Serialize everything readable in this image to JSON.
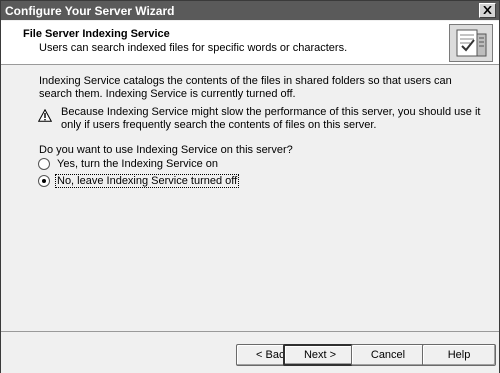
{
  "window": {
    "title": "Configure Your Server Wizard"
  },
  "header": {
    "title": "File Server Indexing Service",
    "subtitle": "Users can search indexed files for specific words or characters."
  },
  "body": {
    "description": "Indexing Service catalogs the contents of the files in shared folders so that users can search them. Indexing Service is currently turned off.",
    "warning": "Because Indexing Service might slow the performance of this server, you should use it only if users frequently search the contents of files on this server.",
    "question": "Do you want to use Indexing Service on this server?",
    "options": [
      {
        "label": "Yes, turn the Indexing Service on",
        "selected": false
      },
      {
        "label": "No, leave Indexing Service turned off",
        "selected": true
      }
    ]
  },
  "buttons": {
    "back": "< Back",
    "next": "Next >",
    "cancel": "Cancel",
    "help": "Help"
  },
  "icons": {
    "close": "close-icon",
    "header": "file-server-icon",
    "warning": "warning-icon"
  }
}
